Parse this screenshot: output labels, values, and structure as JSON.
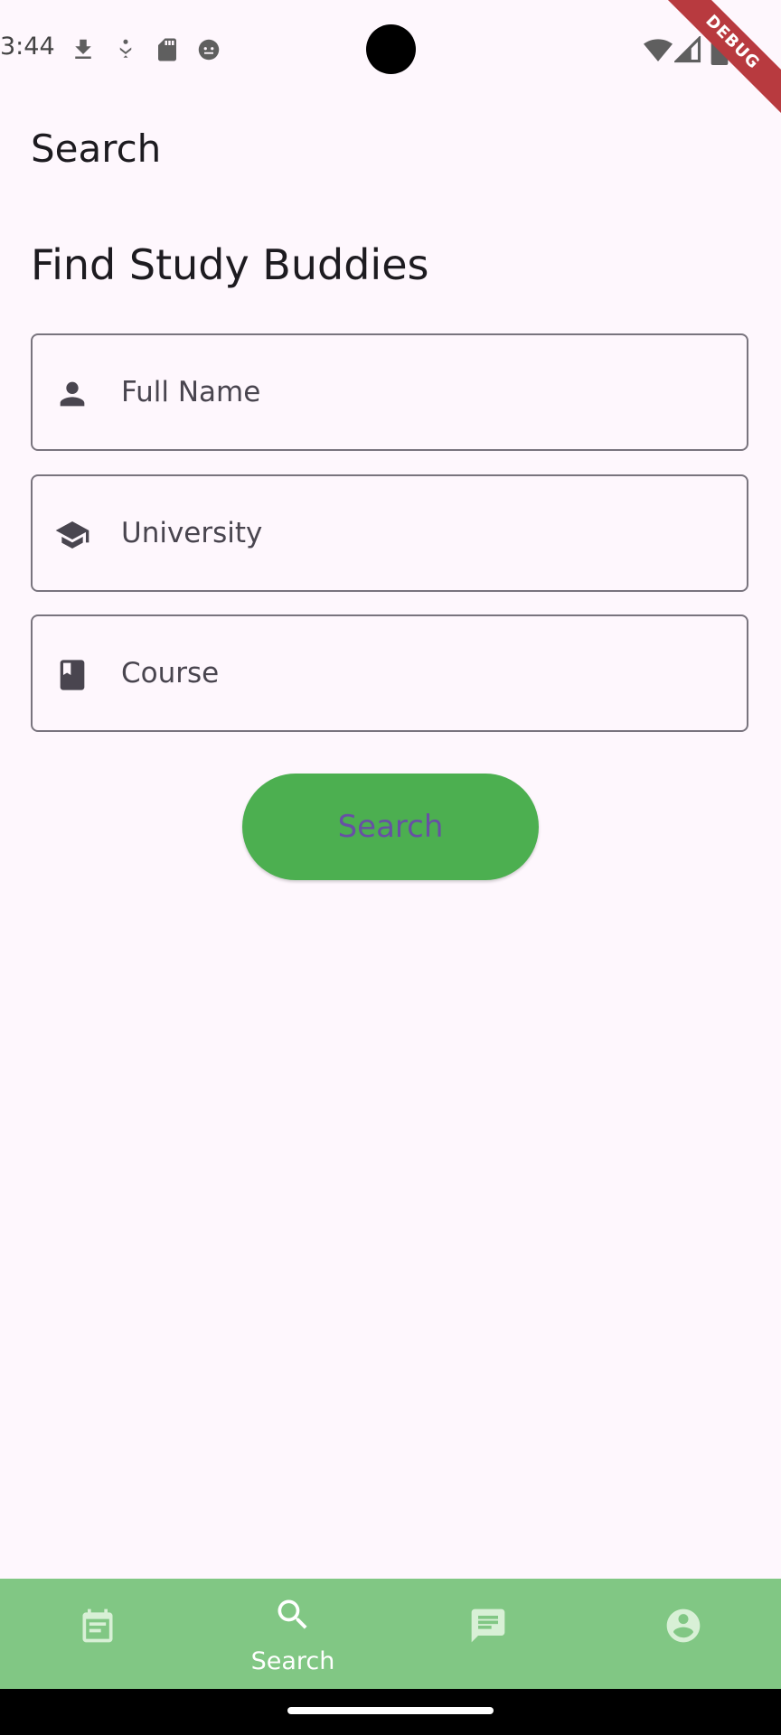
{
  "status_bar": {
    "time": "3:44",
    "icons": [
      "download-icon",
      "usb-debug-icon",
      "sd-card-icon",
      "android-icon",
      "wifi-icon",
      "cell-signal-icon",
      "battery-icon"
    ]
  },
  "debug_banner": "DEBUG",
  "app_bar": {
    "title": "Search"
  },
  "form": {
    "heading": "Find Study Buddies",
    "fields": [
      {
        "placeholder": "Full Name",
        "value": "",
        "icon": "person-icon"
      },
      {
        "placeholder": "University",
        "value": "",
        "icon": "school-icon"
      },
      {
        "placeholder": "Course",
        "value": "",
        "icon": "book-icon"
      }
    ],
    "search_button_label": "Search"
  },
  "bottom_nav": {
    "items": [
      {
        "icon": "article-icon",
        "label": "",
        "active": false
      },
      {
        "icon": "search-icon",
        "label": "Search",
        "active": true
      },
      {
        "icon": "chat-icon",
        "label": "",
        "active": false
      },
      {
        "icon": "account-circle-icon",
        "label": "",
        "active": false
      }
    ]
  },
  "colors": {
    "background": "#fef7fd",
    "button_bg": "#4caf50",
    "button_text": "#6750a4",
    "nav_bg": "#81c784",
    "nav_inactive_icon": "#d8f0d6",
    "field_border": "#79747e",
    "debug_ribbon": "#b83a3f"
  }
}
